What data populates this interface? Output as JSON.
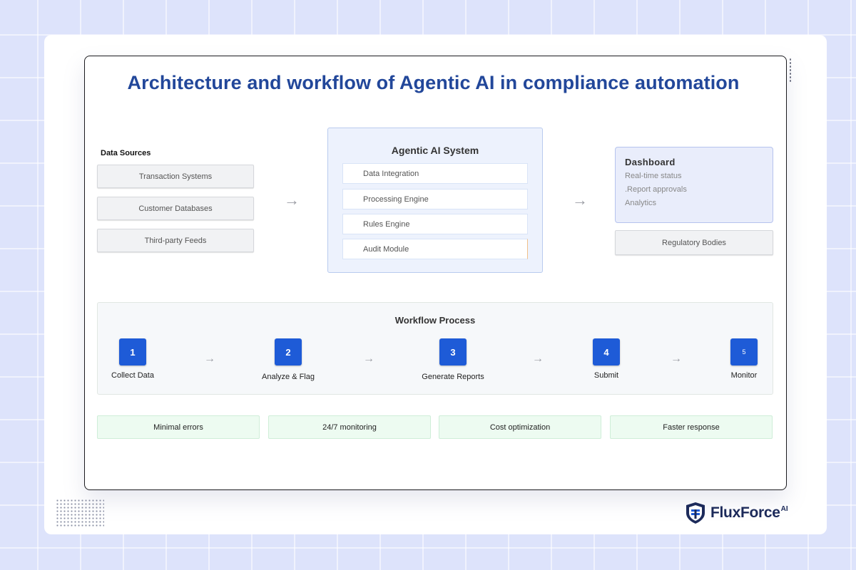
{
  "title": "Architecture and workflow of Agentic AI in compliance automation",
  "data_sources": {
    "label": "Data Sources",
    "items": [
      "Transaction Systems",
      "Customer Databases",
      "Third-party Feeds"
    ]
  },
  "agentic_system": {
    "title": "Agentic AI System",
    "modules": [
      "Data Integration",
      "Processing Engine",
      "Rules Engine",
      "Audit Module"
    ]
  },
  "dashboard": {
    "title": "Dashboard",
    "items": [
      "Real-time status",
      ".Report approvals",
      "Analytics"
    ]
  },
  "regulatory": "Regulatory Bodies",
  "workflow": {
    "title": "Workflow Process",
    "steps": [
      {
        "number": "1",
        "label": "Collect Data"
      },
      {
        "number": "2",
        "label": "Analyze & Flag"
      },
      {
        "number": "3",
        "label": "Generate Reports"
      },
      {
        "number": "4",
        "label": "Submit"
      },
      {
        "number": "5",
        "label": "Monitor"
      }
    ]
  },
  "benefits": [
    "Minimal errors",
    "24/7 monitoring",
    "Cost optimization",
    "Faster response"
  ],
  "brand": {
    "name": "FluxForce",
    "suffix": "AI",
    "color": "#1c2a5a",
    "accent": "#1e5bd7"
  },
  "icons": {
    "flow_arrow": "→",
    "logo": "shield-logo-icon"
  }
}
